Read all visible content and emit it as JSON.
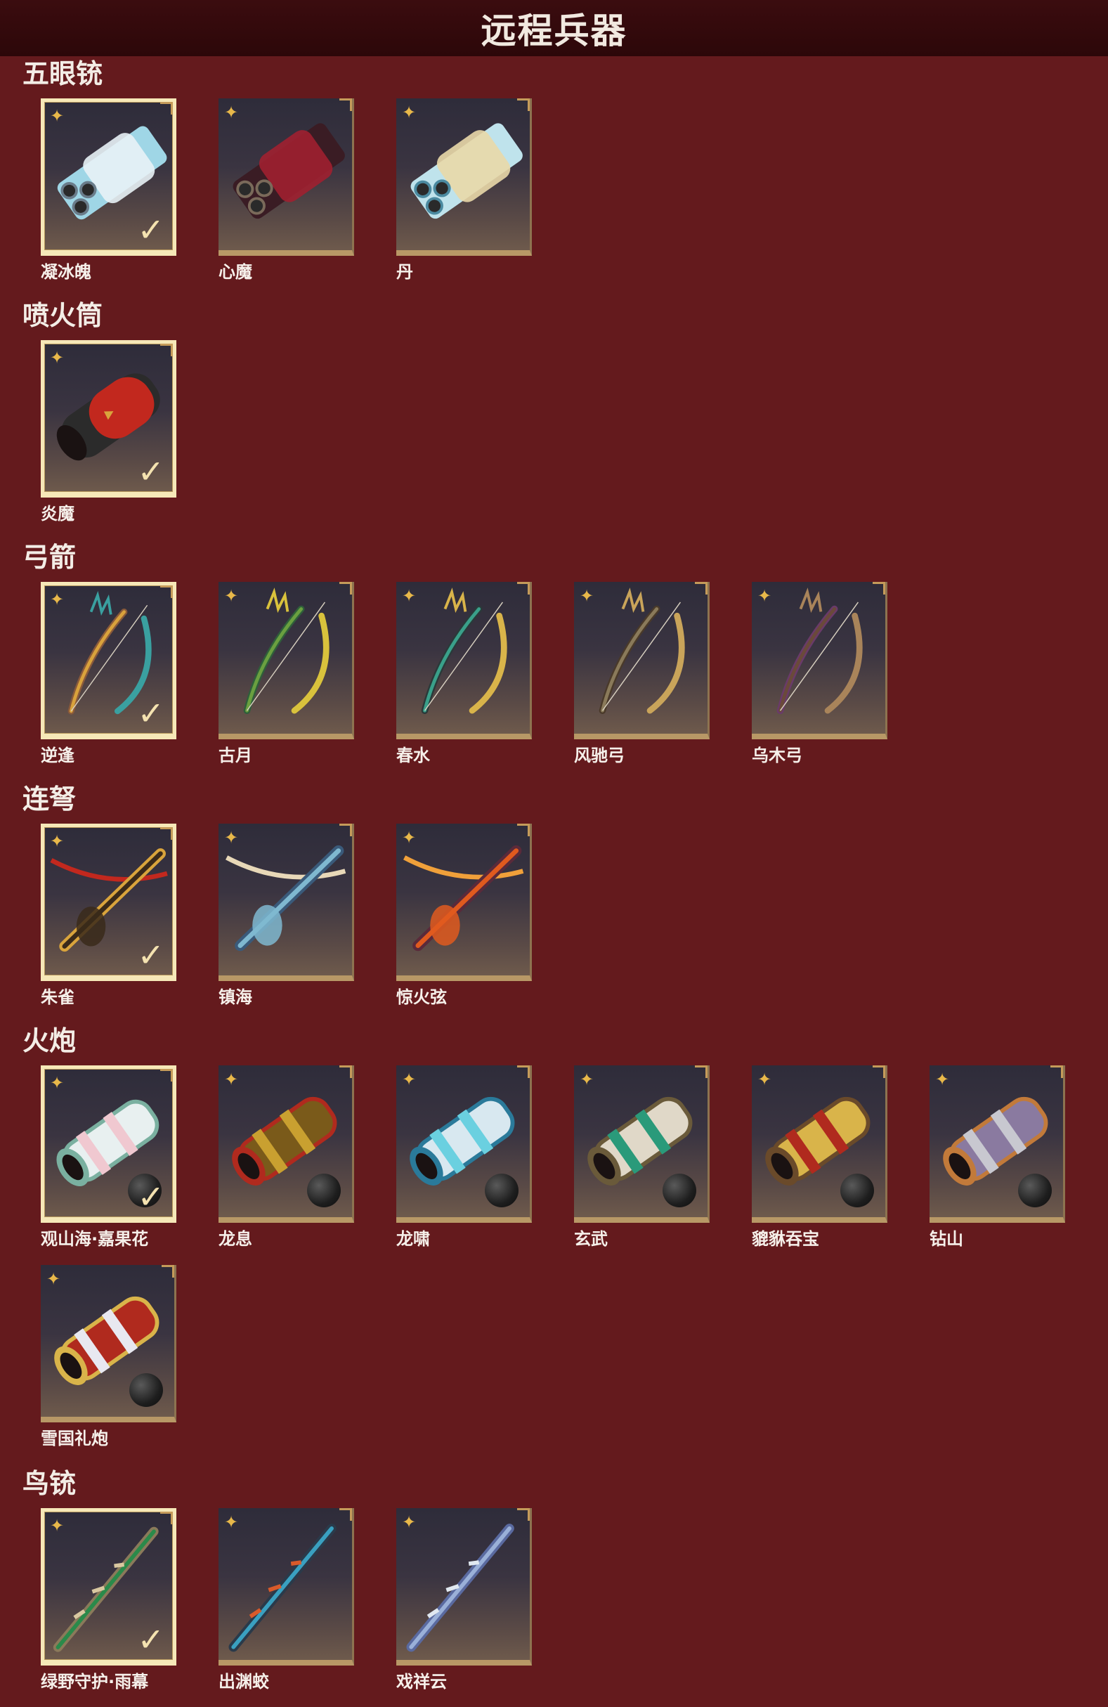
{
  "page_title": "远程兵器",
  "colors": {
    "background": "#641a1d",
    "titlebar": "#2c0709",
    "frame_gold": "#b89866",
    "selected_border": "#f6e8b8"
  },
  "sections": [
    {
      "title": "五眼铳",
      "items": [
        {
          "label": "凝冰魄",
          "selected": true,
          "icon": "ice-handgun-icon"
        },
        {
          "label": "心魔",
          "selected": false,
          "icon": "dark-handgun-icon"
        },
        {
          "label": "丹",
          "selected": false,
          "icon": "cyan-handgun-icon"
        }
      ]
    },
    {
      "title": "喷火筒",
      "items": [
        {
          "label": "炎魔",
          "selected": true,
          "icon": "flamethrower-icon"
        }
      ]
    },
    {
      "title": "弓箭",
      "items": [
        {
          "label": "逆逢",
          "selected": true,
          "icon": "bow-icon"
        },
        {
          "label": "古月",
          "selected": false,
          "icon": "bow-icon"
        },
        {
          "label": "春水",
          "selected": false,
          "icon": "bow-icon"
        },
        {
          "label": "风驰弓",
          "selected": false,
          "icon": "bow-icon"
        },
        {
          "label": "乌木弓",
          "selected": false,
          "icon": "bow-icon"
        }
      ]
    },
    {
      "title": "连弩",
      "items": [
        {
          "label": "朱雀",
          "selected": true,
          "icon": "crossbow-icon"
        },
        {
          "label": "镇海",
          "selected": false,
          "icon": "crossbow-icon"
        },
        {
          "label": "惊火弦",
          "selected": false,
          "icon": "crossbow-icon"
        }
      ]
    },
    {
      "title": "火炮",
      "items": [
        {
          "label": "观山海·嘉果花",
          "selected": true,
          "icon": "cannon-icon"
        },
        {
          "label": "龙息",
          "selected": false,
          "icon": "cannon-icon"
        },
        {
          "label": "龙啸",
          "selected": false,
          "icon": "cannon-icon"
        },
        {
          "label": "玄武",
          "selected": false,
          "icon": "cannon-icon"
        },
        {
          "label": "貔貅吞宝",
          "selected": false,
          "icon": "cannon-icon"
        },
        {
          "label": "钻山",
          "selected": false,
          "icon": "cannon-icon"
        },
        {
          "label": "雪国礼炮",
          "selected": false,
          "icon": "cannon-icon"
        }
      ]
    },
    {
      "title": "鸟铳",
      "items": [
        {
          "label": "绿野守护·雨幕",
          "selected": true,
          "icon": "musket-icon"
        },
        {
          "label": "出渊蛟",
          "selected": false,
          "icon": "musket-icon"
        },
        {
          "label": "戏祥云",
          "selected": false,
          "icon": "musket-icon"
        }
      ]
    }
  ]
}
